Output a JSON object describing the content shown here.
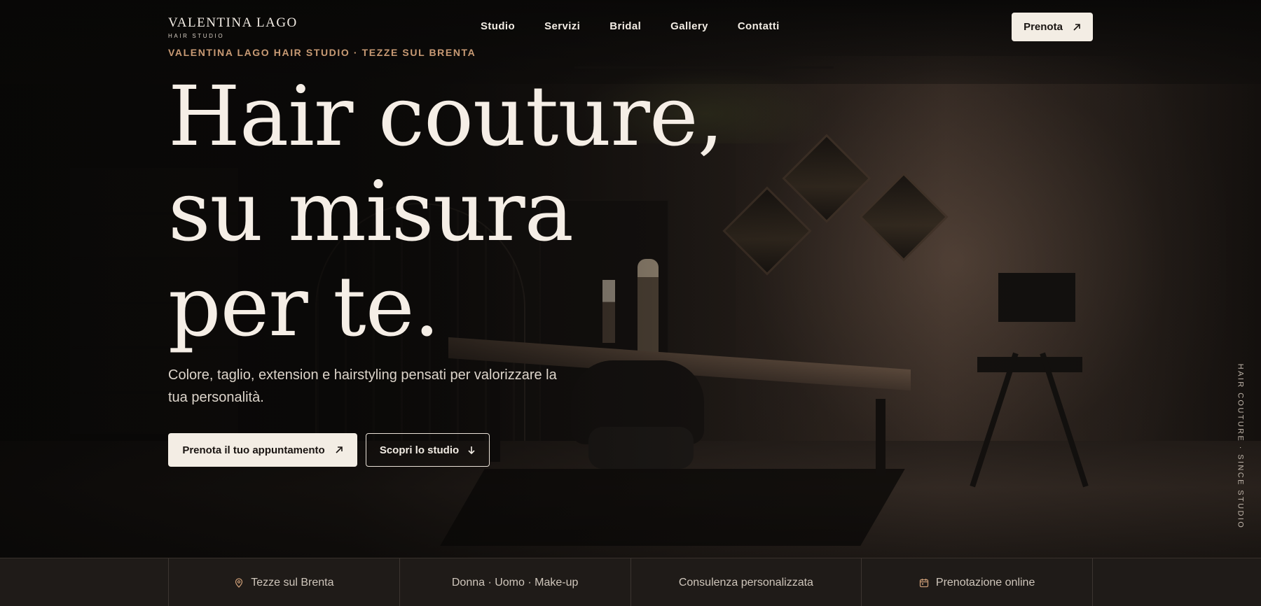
{
  "brand": {
    "name": "VALENTINA LAGO",
    "tagline": "HAIR STUDIO"
  },
  "nav": {
    "links": [
      {
        "label": "Studio"
      },
      {
        "label": "Servizi"
      },
      {
        "label": "Bridal"
      },
      {
        "label": "Gallery"
      },
      {
        "label": "Contatti"
      }
    ],
    "cta_label": "Prenota",
    "cta_icon": "arrow-up-right-icon"
  },
  "hero": {
    "eyebrow": "VALENTINA LAGO HAIR STUDIO · TEZZE SUL BRENTA",
    "headline_lines": [
      "Hair couture,",
      "su misura",
      "per te."
    ],
    "subtitle": "Colore, taglio, extension e hairstyling pensati per valorizzare la tua personalità.",
    "primary_button": "Prenota il tuo appuntamento",
    "secondary_button": "Scopri lo studio",
    "vertical_tag": "HAIR COUTURE · SINCE STUDIO"
  },
  "features": [
    {
      "label": "Tezze sul Brenta",
      "icon": "map-pin-icon"
    },
    {
      "label": "Donna · Uomo · Make-up",
      "icon": ""
    },
    {
      "label": "Consulenza personalizzata",
      "icon": ""
    },
    {
      "label": "Prenotazione online",
      "icon": "calendar-icon"
    }
  ],
  "colors": {
    "accent": "#c89a74",
    "light_button": "#f3ede4",
    "background": "#0d0b0a",
    "bar": "#1f1b18"
  }
}
